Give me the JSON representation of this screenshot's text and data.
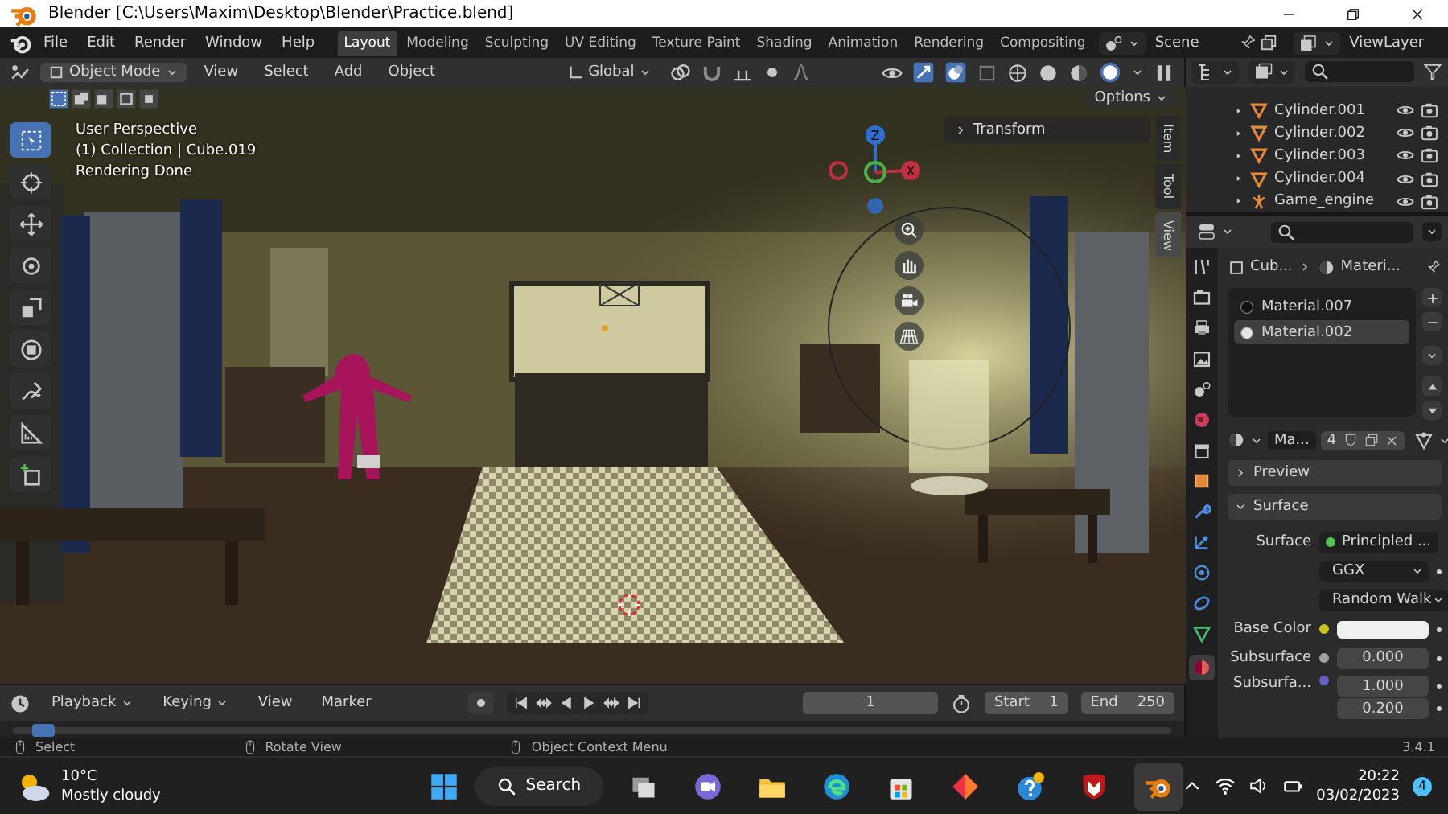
{
  "window": {
    "title": "Blender [C:\\Users\\Maxim\\Desktop\\Blender\\Practice.blend]"
  },
  "menu": [
    "File",
    "Edit",
    "Render",
    "Window",
    "Help"
  ],
  "workspaces": [
    {
      "label": "Layout",
      "selected": true
    },
    {
      "label": "Modeling",
      "selected": false
    },
    {
      "label": "Sculpting",
      "selected": false
    },
    {
      "label": "UV Editing",
      "selected": false
    },
    {
      "label": "Texture Paint",
      "selected": false
    },
    {
      "label": "Shading",
      "selected": false
    },
    {
      "label": "Animation",
      "selected": false
    },
    {
      "label": "Rendering",
      "selected": false
    },
    {
      "label": "Compositing",
      "selected": false
    }
  ],
  "scene": "Scene",
  "view_layer": "ViewLayer",
  "viewport_header": {
    "mode": "Object Mode",
    "menus": [
      "View",
      "Select",
      "Add",
      "Object"
    ],
    "orientation": "Global",
    "options": "Options"
  },
  "viewport": {
    "overlay_text": [
      "User Perspective",
      "(1) Collection | Cube.019",
      "Rendering Done"
    ],
    "axes": [
      "Z",
      "X"
    ],
    "transform_panel": "Transform",
    "side_tabs": [
      {
        "label": "Item",
        "selected": false
      },
      {
        "label": "Tool",
        "selected": false
      },
      {
        "label": "View",
        "selected": true
      }
    ]
  },
  "outliner": {
    "items": [
      {
        "name": "Cylinder.001",
        "kind": "mesh"
      },
      {
        "name": "Cylinder.002",
        "kind": "mesh"
      },
      {
        "name": "Cylinder.003",
        "kind": "mesh"
      },
      {
        "name": "Cylinder.004",
        "kind": "mesh"
      },
      {
        "name": "Game_engine",
        "kind": "armature"
      }
    ]
  },
  "properties": {
    "breadcrumb": [
      "Cub...",
      "Materi..."
    ],
    "materials": [
      {
        "name": "Material.007",
        "selected": false
      },
      {
        "name": "Material.002",
        "selected": true
      }
    ],
    "material_name": "Ma...",
    "users": "4",
    "panels": [
      {
        "label": "Preview",
        "expanded": false
      },
      {
        "label": "Surface",
        "expanded": true
      }
    ],
    "fields": [
      {
        "kind": "shader",
        "label": "Surface",
        "value": "Principled ...",
        "color": "#4fc24f"
      },
      {
        "kind": "dropdown",
        "value": "GGX"
      },
      {
        "kind": "dropdown",
        "value": "Random Walk"
      },
      {
        "kind": "color",
        "label": "Base Color",
        "color": "#c7c718"
      },
      {
        "kind": "number",
        "label": "Subsurface",
        "value": "0.000",
        "color": "#a1a1a1"
      },
      {
        "kind": "vector",
        "label": "Subsurfa...",
        "values": [
          "1.000",
          "0.200"
        ],
        "color": "#6363c7"
      }
    ]
  },
  "timeline": {
    "menus": [
      "Playback",
      "Keying",
      "View",
      "Marker"
    ],
    "current_frame": "1",
    "start_label": "Start",
    "start": "1",
    "end_label": "End",
    "end": "250"
  },
  "status_bar": {
    "hints": [
      "Select",
      "Rotate View",
      "Object Context Menu"
    ],
    "version": "3.4.1"
  },
  "taskbar": {
    "temperature": "10°C",
    "condition": "Mostly cloudy",
    "search": "Search",
    "apps": [
      {
        "kind": "task-view",
        "active": false
      },
      {
        "kind": "chat",
        "active": false
      },
      {
        "kind": "folder",
        "active": false
      },
      {
        "kind": "browser",
        "active": false
      },
      {
        "kind": "store",
        "active": false
      },
      {
        "kind": "diamond",
        "active": false
      },
      {
        "kind": "help",
        "active": false
      },
      {
        "kind": "shield",
        "active": false
      },
      {
        "kind": "blender",
        "active": true
      }
    ],
    "time": "20:22",
    "date": "03/02/2023",
    "notifications": "4"
  }
}
